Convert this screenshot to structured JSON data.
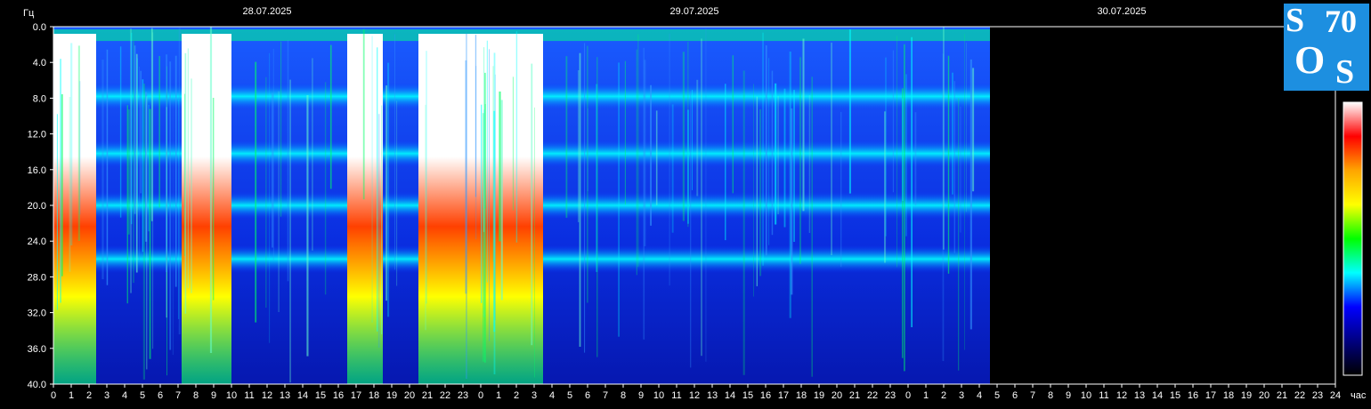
{
  "chart_data": {
    "type": "heatmap",
    "title": "",
    "ylabel": "Гц",
    "xlabel": "час",
    "ylim": [
      0,
      40
    ],
    "y_ticks": [
      "0.0",
      "4.0",
      "8.0",
      "12.0",
      "16.0",
      "20.0",
      "24.0",
      "28.0",
      "32.0",
      "36.0",
      "40.0"
    ],
    "dates": [
      "28.07.2025",
      "29.07.2025",
      "30.07.2025"
    ],
    "hours_per_day": 24,
    "x_tick_labels": [
      "0",
      "1",
      "2",
      "3",
      "4",
      "5",
      "6",
      "7",
      "8",
      "9",
      "10",
      "11",
      "12",
      "13",
      "14",
      "15",
      "16",
      "17",
      "18",
      "19",
      "20",
      "21",
      "22",
      "23",
      "0",
      "1",
      "2",
      "3",
      "4",
      "5",
      "6",
      "7",
      "8",
      "9",
      "10",
      "11",
      "12",
      "13",
      "14",
      "15",
      "16",
      "17",
      "18",
      "19",
      "20",
      "21",
      "22",
      "23",
      "0",
      "1",
      "2",
      "3",
      "4",
      "5",
      "6",
      "7",
      "8",
      "9",
      "10",
      "11",
      "12",
      "13",
      "14",
      "15",
      "16",
      "17",
      "18",
      "19",
      "20",
      "21",
      "22",
      "23",
      "24"
    ],
    "data_end_hour": 52.6,
    "saturation_periods_hours": [
      [
        0,
        2.4
      ],
      [
        7.2,
        10
      ],
      [
        16.5,
        18.5
      ],
      [
        20.5,
        27.5
      ]
    ],
    "resonance_bands_hz": [
      7.8,
      14.2,
      20.0,
      26.0
    ],
    "colorbar": [
      "#ffffff",
      "#ff0000",
      "#ffa500",
      "#ffff00",
      "#00ff00",
      "#00ffff",
      "#0000ff",
      "#000080",
      "#000000"
    ]
  },
  "logo": {
    "text_top_left": "S",
    "text_top_right": "70",
    "text_bottom_left": "O",
    "text_bottom_right": "S"
  }
}
